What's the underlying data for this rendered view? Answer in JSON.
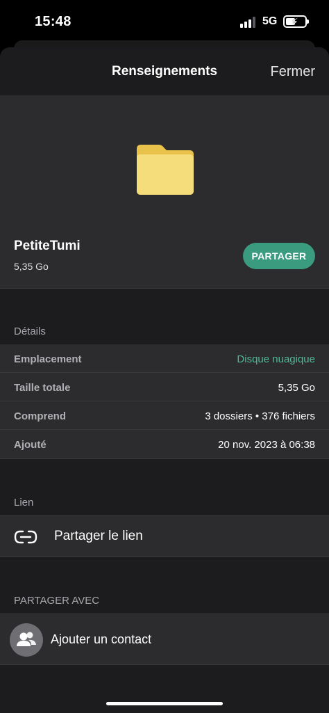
{
  "status_bar": {
    "time": "15:48",
    "network": "5G",
    "signal_bars_active": 3,
    "signal_bars_total": 4,
    "battery_level": 0.5,
    "icons": [
      "signal-icon",
      "battery-charging-icon"
    ]
  },
  "nav": {
    "title": "Renseignements",
    "close_label": "Fermer"
  },
  "item": {
    "icon": "folder-icon",
    "name": "PetiteTumi",
    "size": "5,35 Go",
    "share_label": "PARTAGER"
  },
  "details": {
    "header": "Détails",
    "rows": [
      {
        "key": "Emplacement",
        "value": "Disque nuagique"
      },
      {
        "key": "Taille totale",
        "value": "5,35 Go"
      },
      {
        "key": "Comprend",
        "value": "3 dossiers • 376 fichiers"
      },
      {
        "key": "Ajouté",
        "value": "20 nov. 2023 à 06:38"
      }
    ]
  },
  "link": {
    "header": "Lien",
    "icon": "link-icon",
    "label": "Partager le lien"
  },
  "share_with": {
    "header": "PARTAGER AVEC",
    "icon": "add-contact-icon",
    "label": "Ajouter un contact"
  },
  "colors": {
    "accent": "#3b9b7e",
    "accent_text": "#4fb897",
    "folder": "#f5dd7c",
    "background": "#1c1c1e",
    "card": "#2c2c2e"
  }
}
